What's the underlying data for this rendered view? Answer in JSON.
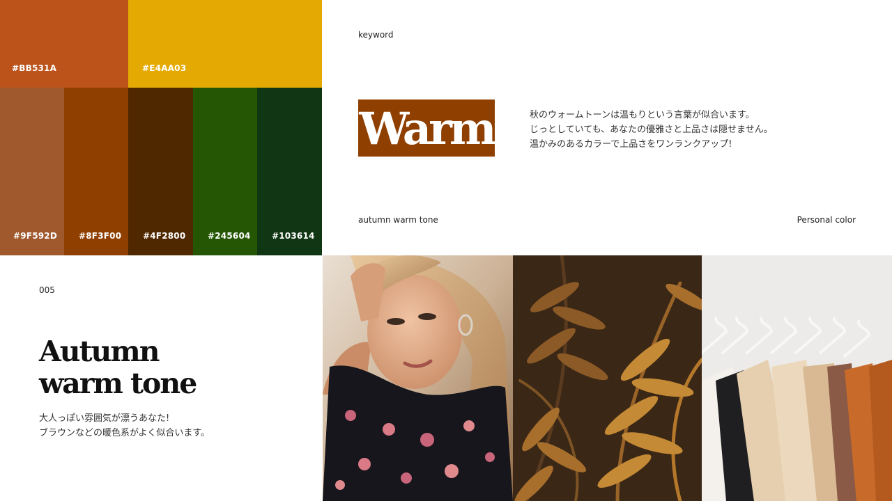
{
  "palette": {
    "top": [
      {
        "hex": "#BB531A",
        "label": "#BB531A"
      },
      {
        "hex": "#E4AA03",
        "label": "#E4AA03"
      }
    ],
    "bottom": [
      {
        "hex": "#9F592D",
        "label": "#9F592D"
      },
      {
        "hex": "#8F3F00",
        "label": "#8F3F00"
      },
      {
        "hex": "#4F2800",
        "label": "#4F2800"
      },
      {
        "hex": "#245604",
        "label": "#245604"
      },
      {
        "hex": "#103614",
        "label": "#103614"
      }
    ]
  },
  "keyword_section": {
    "keyword_label": "keyword",
    "keyword_word": "Warm",
    "description_lines": [
      "秋のウォームトーンは温もりという言葉が似合います。",
      "じっとしていても、あなたの優雅さと上品さは隠せません。",
      "温かみのあるカラーで上品さをワンランクアップ!"
    ],
    "footer_left": "autumn warm tone",
    "footer_right": "Personal color"
  },
  "title_section": {
    "page_number": "005",
    "title_line1": "Autumn",
    "title_line2": "warm tone",
    "description_lines": [
      "大人っぽい雰囲気が漂うあなた!",
      "ブラウンなどの暖色系がよく似合います。"
    ]
  }
}
